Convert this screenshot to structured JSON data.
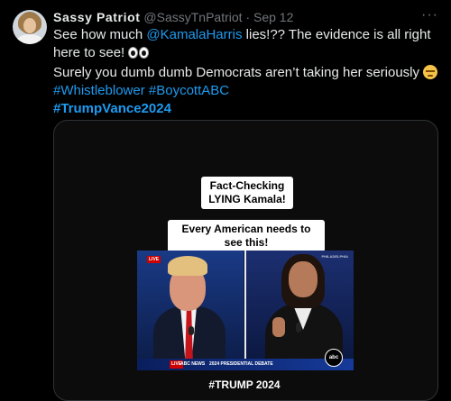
{
  "tweet": {
    "display_name": "Sassy Patriot",
    "handle": "@SassyTnPatriot",
    "separator": "·",
    "date": "Sep 12",
    "more_label": "···",
    "text_line1_part1": "See how much ",
    "mention": "@KamalaHarris",
    "text_line1_part2": " lies!?? The evidence is all right",
    "text_line2": "here to see! ",
    "text_line3": "Surely you dumb dumb Democrats aren’t taking her seriously ",
    "hashtag1": "#Whistleblower",
    "hashtag2": "#BoycottABC",
    "hashtag3": "#TrumpVance2024"
  },
  "media": {
    "caption_top": "Fact-Checking LYING Kamala!",
    "caption_middle": "Every American needs to see this!",
    "live_badge": "LIVE",
    "ticker_live": "LIVE",
    "ticker_brand": "ABC NEWS",
    "ticker_text": "2024 PRESIDENTIAL DEBATE",
    "network_logo": "abc",
    "right_tag": "PHILADELPHIA",
    "caption_bottom": "#TRUMP 2024"
  },
  "icons": {
    "avatar": "avatar",
    "eyes_emoji": "eyes-icon",
    "unamused_emoji": "unamused-face-icon"
  }
}
